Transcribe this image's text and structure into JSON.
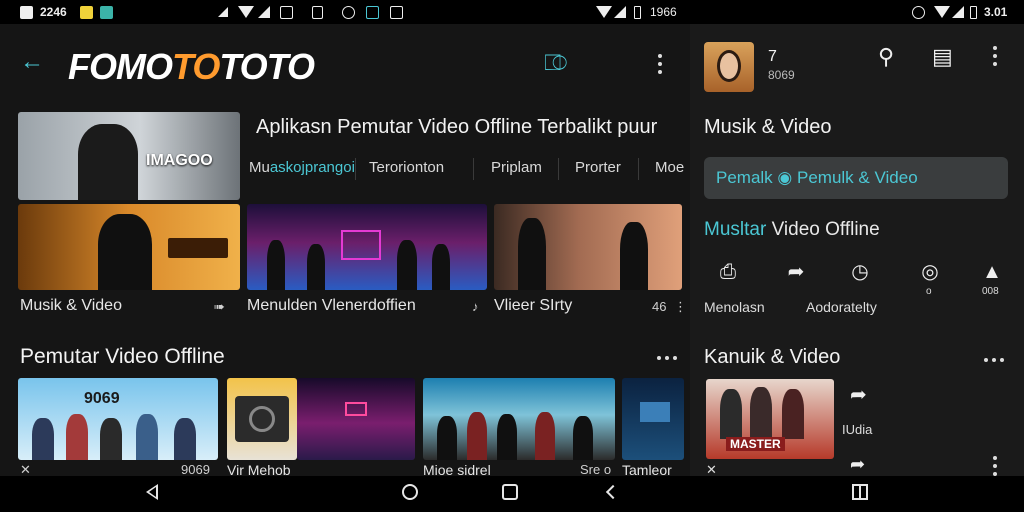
{
  "status_bar": {
    "time_left": "2246",
    "time_center": "1966",
    "time_right": "3.01"
  },
  "header": {
    "app_name_prefix": "FOMO",
    "app_name_accent": "TO",
    "app_name_suffix": "TOTO",
    "back_icon": "arrow-left-icon",
    "cast_icon": "cast-icon"
  },
  "featured": {
    "headline": "Aplikasn Pemutar Video Offline Terbalikt puur",
    "hero_caption": "IMAGOO"
  },
  "category_tabs": [
    {
      "label_prefix": "Mu",
      "label_accent": "askojprangoi"
    },
    {
      "label_prefix": "Terorionton",
      "label_accent": ""
    },
    {
      "label_prefix": "Priplam",
      "label_accent": ""
    },
    {
      "label_prefix": "Prorter",
      "label_accent": ""
    },
    {
      "label_prefix": "Moe",
      "label_accent": ""
    }
  ],
  "video_row": {
    "items": [
      {
        "label": "Musik & Video",
        "icon": "share-icon"
      },
      {
        "label": "Menulden Vlenerdoffien",
        "icon": "music-note-icon"
      },
      {
        "label": "Vlieer SIrty",
        "icon": "more-icon"
      }
    ],
    "trailing_text": "46"
  },
  "section_offline": {
    "title": "Pemutar Video Offline",
    "cards": [
      {
        "title": "",
        "badge": "9069"
      },
      {
        "title": "Vir Mehob",
        "badge": ""
      },
      {
        "title": "",
        "badge": ""
      },
      {
        "title": "Mioe sidrel",
        "badge": "Sre o"
      },
      {
        "title": "Tamleor",
        "badge": ""
      }
    ]
  },
  "right_panel": {
    "profile_count": "7",
    "profile_sub": "8069",
    "title": "Musik & Video",
    "pill_prefix": "Pemalk",
    "pill_text": "Pemulk & Video",
    "subtitle_accent": "Mu",
    "subtitle_accent2": "sltar",
    "subtitle_rest": " Video Offline",
    "actions": [
      {
        "icon": "download-icon",
        "label": "Menolasn"
      },
      {
        "icon": "share-icon",
        "label": "Aodoratelty"
      },
      {
        "icon": "timer-icon",
        "label": ""
      },
      {
        "icon": "info-icon",
        "label": ""
      },
      {
        "icon": "person-icon",
        "label": ""
      }
    ],
    "action_small_3": "o",
    "action_small_5": "008",
    "section_title": "Kanuik & Video",
    "share_label": "IUdia",
    "card_badge": "MASTER"
  },
  "nav_bar": {
    "buttons": [
      "back-icon",
      "home-icon",
      "recents-icon",
      "chevron-left-icon",
      "split-screen-icon"
    ]
  }
}
